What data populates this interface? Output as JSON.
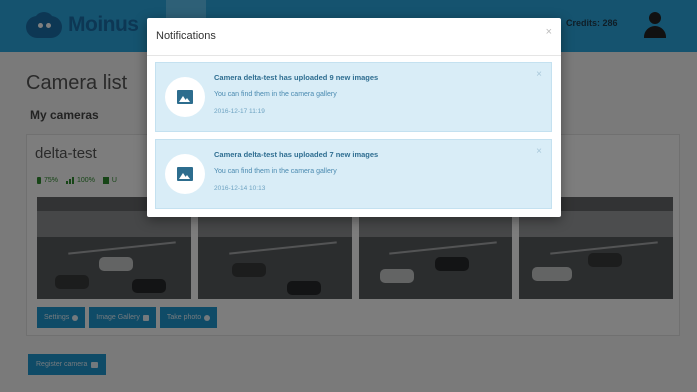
{
  "navbar": {
    "brand": "Moinus",
    "credits": "Credits: 286"
  },
  "page": {
    "title": "Camera list",
    "subtitle": "My cameras"
  },
  "camera": {
    "name": "delta-test",
    "battery": "75%",
    "signal": "100%",
    "storage": "U",
    "buttons": {
      "settings": "Settings",
      "gallery": "Image Gallery",
      "photo": "Take photo"
    }
  },
  "register_label": "Register camera",
  "modal": {
    "title": "Notifications",
    "close": "×",
    "notifications": [
      {
        "title": "Camera delta-test has uploaded 9 new images",
        "body": "You can find them in the camera gallery",
        "time": "2016-12-17 11:19",
        "close": "×",
        "icon": "image-icon"
      },
      {
        "title": "Camera delta-test has uploaded 7 new images",
        "body": "You can find them in the camera gallery",
        "time": "2016-12-14 10:13",
        "close": "×",
        "icon": "image-icon"
      }
    ]
  },
  "colors": {
    "navbar": "#2aa6df",
    "primary_button": "#1f96cf",
    "notification_bg": "#d9edf7",
    "status_green": "#2e8b2e"
  }
}
